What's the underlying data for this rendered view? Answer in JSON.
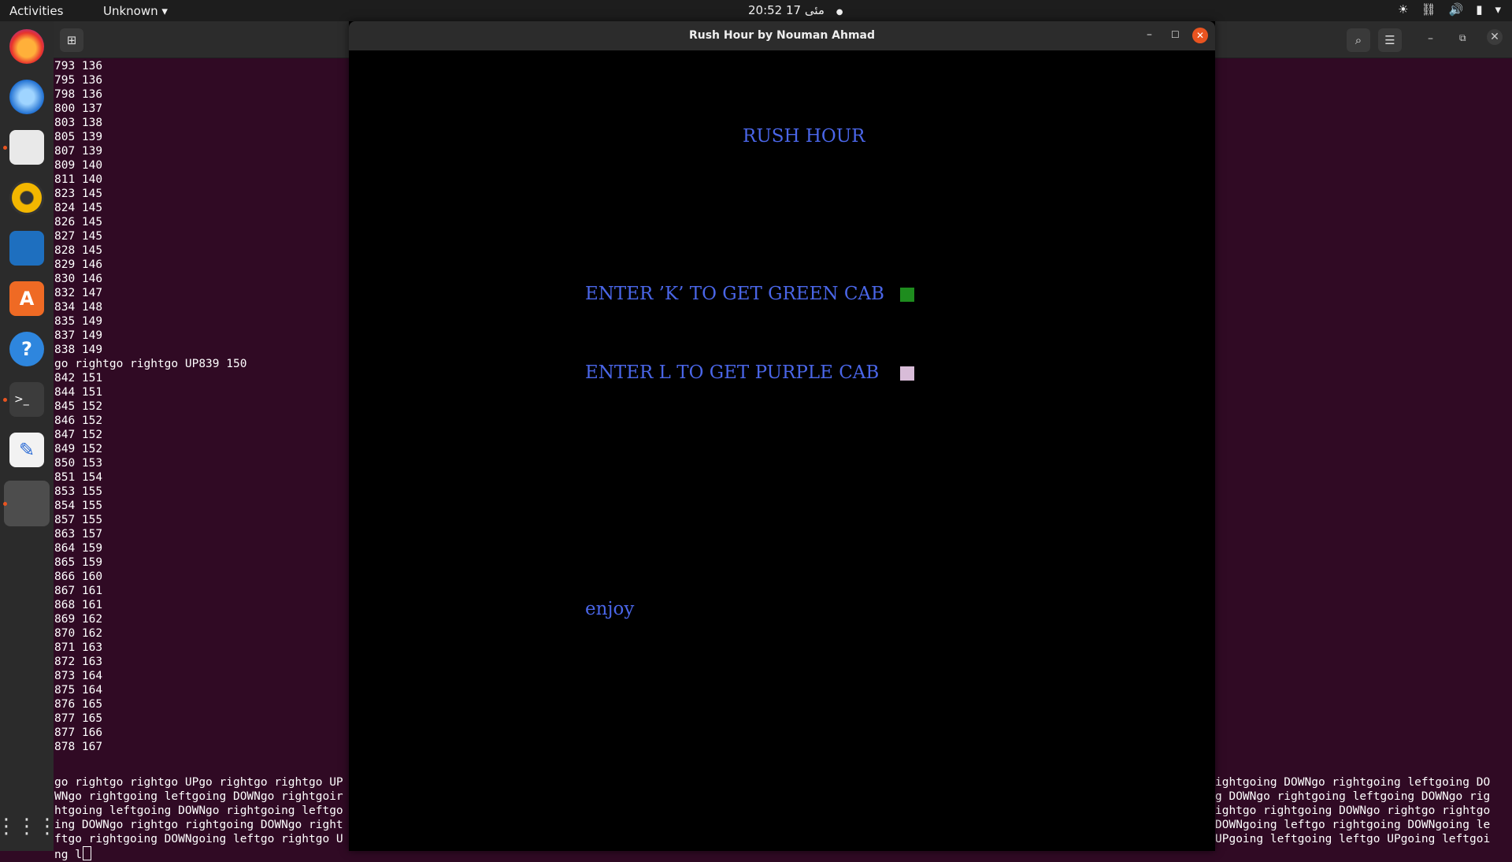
{
  "topbar": {
    "activities": "Activities",
    "app_menu": "Unknown ▾",
    "clock": "20:52  17 مئی",
    "clock_indicator": "●"
  },
  "dock": {
    "items": [
      "firefox-icon",
      "thunderbird-icon",
      "files-icon",
      "rhythmbox-icon",
      "libreoffice-writer-icon",
      "software-icon",
      "help-icon",
      "terminal-icon",
      "text-editor-icon",
      "running-app-icon",
      "show-apps-icon"
    ]
  },
  "terminal": {
    "lines": [
      "793 136",
      "795 136",
      "798 136",
      "800 137",
      "803 138",
      "805 139",
      "807 139",
      "809 140",
      "811 140",
      "823 145",
      "824 145",
      "826 145",
      "827 145",
      "828 145",
      "829 146",
      "830 146",
      "832 147",
      "834 148",
      "835 149",
      "837 149",
      "838 149",
      "go rightgo rightgo UP839 150",
      "842 151",
      "844 151",
      "845 152",
      "846 152",
      "847 152",
      "849 152",
      "850 153",
      "851 154",
      "853 155",
      "854 155",
      "857 155",
      "863 157",
      "864 159",
      "865 159",
      "866 160",
      "867 161",
      "868 161",
      "869 162",
      "870 162",
      "871 163",
      "872 163",
      "873 164",
      "875 164",
      "876 165",
      "877 165",
      "877 166",
      "878 167"
    ],
    "tail_left": [
      "go rightgo rightgo UPgo rightgo rightgo UP",
      "WNgo rightgoing leftgoing DOWNgo rightgoir",
      "htgoing leftgoing DOWNgo rightgoing leftgo",
      "ing DOWNgo rightgo rightgoing DOWNgo right",
      "ftgo rightgoing DOWNgoing leftgo rightgo U",
      "ng l"
    ],
    "tail_right": [
      "ightgoing DOWNgo rightgoing leftgoing DO",
      "g DOWNgo rightgoing leftgoing DOWNgo rig",
      "ightgo rightgoing DOWNgo rightgo rightgo",
      "DOWNgoing leftgo rightgoing DOWNgoing le",
      "UPgoing leftgoing leftgo UPgoing leftgoi"
    ]
  },
  "game": {
    "window_title": "Rush Hour by Nouman Ahmad",
    "heading": "RUSH HOUR",
    "green_option": "ENTER ’K’ TO GET GREEN CAB",
    "purple_option": "ENTER L TO GET PURPLE CAB",
    "footer": "enjoy",
    "colors": {
      "text": "#4a66e8",
      "green_cab": "#1e8c1e",
      "purple_cab": "#d8bcd8"
    }
  }
}
